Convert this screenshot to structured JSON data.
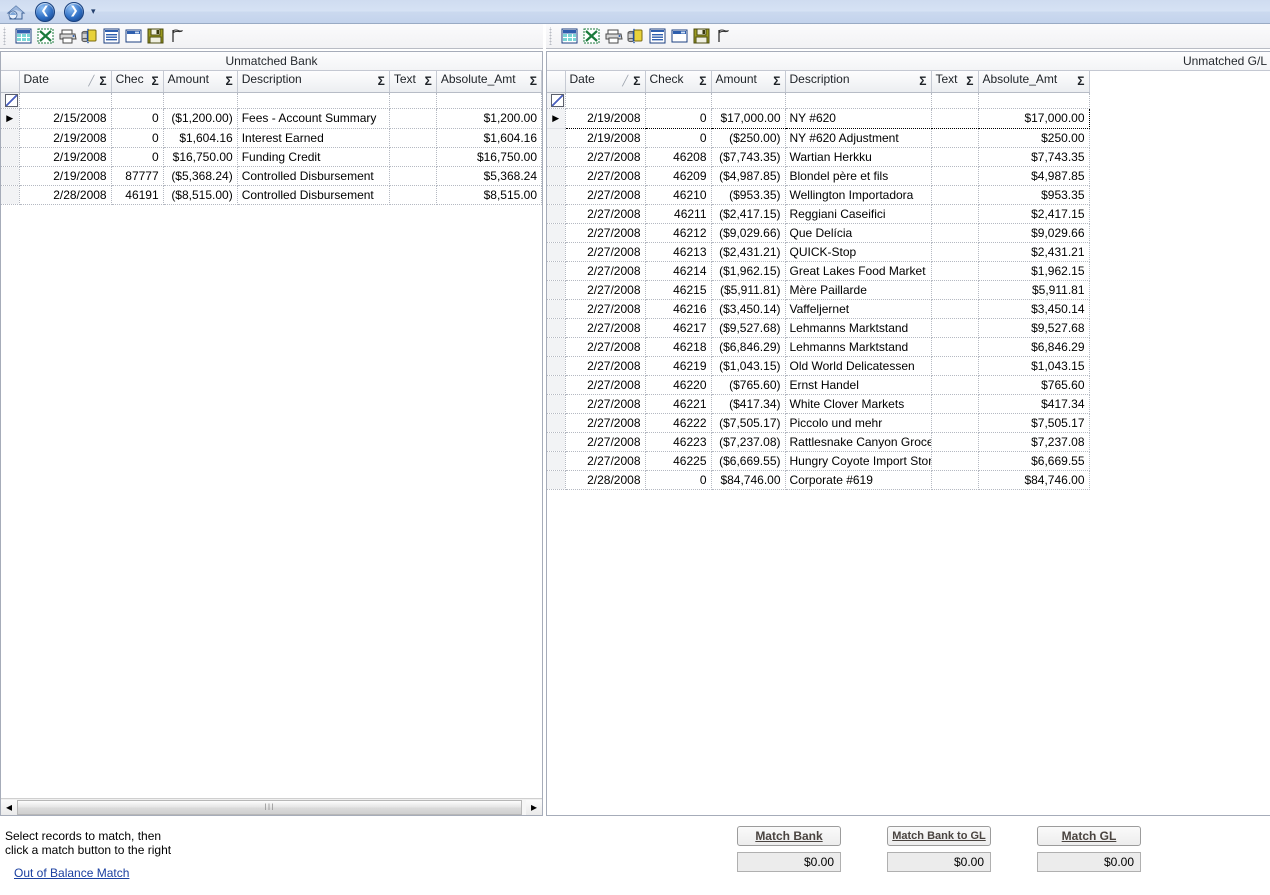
{
  "navbar": {
    "home_title": "Home",
    "back_glyph": "❮",
    "forward_glyph": "❯",
    "dropdown_glyph": "▾"
  },
  "toolbar": {
    "items": [
      {
        "name": "grid-view-icon",
        "tooltip": "Grid"
      },
      {
        "name": "export-excel-icon",
        "tooltip": "Export to Excel"
      },
      {
        "name": "print-icon",
        "tooltip": "Print"
      },
      {
        "name": "database-refresh-icon",
        "tooltip": "Refresh Data"
      },
      {
        "name": "report-view-icon",
        "tooltip": "Report"
      },
      {
        "name": "window-view-icon",
        "tooltip": "Window"
      },
      {
        "name": "save-icon",
        "tooltip": "Save"
      },
      {
        "name": "flag-icon",
        "tooltip": "Flag"
      }
    ]
  },
  "left_panel": {
    "title": "Unmatched Bank",
    "columns": [
      {
        "label": "Date",
        "sorted": true
      },
      {
        "label": "Chec",
        "sorted": false
      },
      {
        "label": "Amount",
        "sorted": false
      },
      {
        "label": "Description",
        "sorted": false
      },
      {
        "label": "Text",
        "sorted": false
      },
      {
        "label": "Absolute_Amt",
        "sorted": false
      }
    ],
    "rows": [
      {
        "date": "2/15/2008",
        "check": "0",
        "amount": "($1,200.00)",
        "description": "Fees - Account Summary",
        "text": "",
        "absolute": "$1,200.00"
      },
      {
        "date": "2/19/2008",
        "check": "0",
        "amount": "$1,604.16",
        "description": "Interest Earned",
        "text": "",
        "absolute": "$1,604.16"
      },
      {
        "date": "2/19/2008",
        "check": "0",
        "amount": "$16,750.00",
        "description": "Funding Credit",
        "text": "",
        "absolute": "$16,750.00"
      },
      {
        "date": "2/19/2008",
        "check": "87777",
        "amount": "($5,368.24)",
        "description": "Controlled Disbursement",
        "text": "",
        "absolute": "$5,368.24"
      },
      {
        "date": "2/28/2008",
        "check": "46191",
        "amount": "($8,515.00)",
        "description": "Controlled Disbursement",
        "text": "",
        "absolute": "$8,515.00"
      }
    ],
    "scrollbar": {
      "left_arrow": "◂",
      "right_arrow": "▸",
      "thumb_grip": "III"
    }
  },
  "right_panel": {
    "title": "Unmatched G/L",
    "columns": [
      {
        "label": "Date",
        "sorted": true
      },
      {
        "label": "Check",
        "sorted": false
      },
      {
        "label": "Amount",
        "sorted": false
      },
      {
        "label": "Description",
        "sorted": false
      },
      {
        "label": "Text",
        "sorted": false
      },
      {
        "label": "Absolute_Amt",
        "sorted": false
      }
    ],
    "rows": [
      {
        "date": "2/19/2008",
        "check": "0",
        "amount": "$17,000.00",
        "description": "NY #620",
        "text": "",
        "absolute": "$17,000.00",
        "selected": true
      },
      {
        "date": "2/19/2008",
        "check": "0",
        "amount": "($250.00)",
        "description": "NY #620 Adjustment",
        "text": "",
        "absolute": "$250.00"
      },
      {
        "date": "2/27/2008",
        "check": "46208",
        "amount": "($7,743.35)",
        "description": "Wartian Herkku",
        "text": "",
        "absolute": "$7,743.35"
      },
      {
        "date": "2/27/2008",
        "check": "46209",
        "amount": "($4,987.85)",
        "description": "Blondel père et fils",
        "text": "",
        "absolute": "$4,987.85"
      },
      {
        "date": "2/27/2008",
        "check": "46210",
        "amount": "($953.35)",
        "description": "Wellington Importadora",
        "text": "",
        "absolute": "$953.35"
      },
      {
        "date": "2/27/2008",
        "check": "46211",
        "amount": "($2,417.15)",
        "description": "Reggiani Caseifici",
        "text": "",
        "absolute": "$2,417.15"
      },
      {
        "date": "2/27/2008",
        "check": "46212",
        "amount": "($9,029.66)",
        "description": "Que Delícia",
        "text": "",
        "absolute": "$9,029.66"
      },
      {
        "date": "2/27/2008",
        "check": "46213",
        "amount": "($2,431.21)",
        "description": "QUICK-Stop",
        "text": "",
        "absolute": "$2,431.21"
      },
      {
        "date": "2/27/2008",
        "check": "46214",
        "amount": "($1,962.15)",
        "description": "Great Lakes Food Market",
        "text": "",
        "absolute": "$1,962.15"
      },
      {
        "date": "2/27/2008",
        "check": "46215",
        "amount": "($5,911.81)",
        "description": "Mère Paillarde",
        "text": "",
        "absolute": "$5,911.81"
      },
      {
        "date": "2/27/2008",
        "check": "46216",
        "amount": "($3,450.14)",
        "description": "Vaffeljernet",
        "text": "",
        "absolute": "$3,450.14"
      },
      {
        "date": "2/27/2008",
        "check": "46217",
        "amount": "($9,527.68)",
        "description": "Lehmanns Marktstand",
        "text": "",
        "absolute": "$9,527.68"
      },
      {
        "date": "2/27/2008",
        "check": "46218",
        "amount": "($6,846.29)",
        "description": "Lehmanns Marktstand",
        "text": "",
        "absolute": "$6,846.29"
      },
      {
        "date": "2/27/2008",
        "check": "46219",
        "amount": "($1,043.15)",
        "description": "Old World Delicatessen",
        "text": "",
        "absolute": "$1,043.15"
      },
      {
        "date": "2/27/2008",
        "check": "46220",
        "amount": "($765.60)",
        "description": "Ernst Handel",
        "text": "",
        "absolute": "$765.60"
      },
      {
        "date": "2/27/2008",
        "check": "46221",
        "amount": "($417.34)",
        "description": "White Clover Markets",
        "text": "",
        "absolute": "$417.34"
      },
      {
        "date": "2/27/2008",
        "check": "46222",
        "amount": "($7,505.17)",
        "description": "Piccolo und mehr",
        "text": "",
        "absolute": "$7,505.17"
      },
      {
        "date": "2/27/2008",
        "check": "46223",
        "amount": "($7,237.08)",
        "description": "Rattlesnake Canyon Groce..",
        "text": "",
        "absolute": "$7,237.08"
      },
      {
        "date": "2/27/2008",
        "check": "46225",
        "amount": "($6,669.55)",
        "description": "Hungry Coyote Import Store",
        "text": "",
        "absolute": "$6,669.55"
      },
      {
        "date": "2/28/2008",
        "check": "0",
        "amount": "$84,746.00",
        "description": "Corporate #619",
        "text": "",
        "absolute": "$84,746.00"
      }
    ]
  },
  "footer": {
    "hint_line1": "Select records to match, then",
    "hint_line2": "click a match button to the right",
    "out_of_balance_link": "Out of Balance Match",
    "actions": [
      {
        "label": "Match Bank",
        "amount": "$0.00"
      },
      {
        "label": "Match Bank to GL",
        "amount": "$0.00"
      },
      {
        "label": "Match GL",
        "amount": "$0.00"
      }
    ]
  },
  "glyphs": {
    "sigma": "Σ",
    "sort_asc": "╱",
    "row_pointer": "▶"
  },
  "colors": {
    "navbar_top": "#cfdcf0",
    "navbar_bottom": "#c3d3ec",
    "panel_border": "#a6acb9",
    "link": "#1a3fa0",
    "button_text": "#4a4440"
  }
}
